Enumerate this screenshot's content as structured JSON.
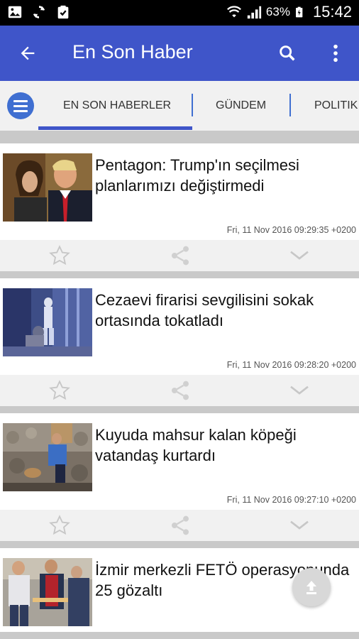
{
  "status_bar": {
    "battery": "63%",
    "time": "15:42"
  },
  "app_bar": {
    "title": "En Son Haber"
  },
  "tabs": [
    {
      "label": "EN SON HABERLER",
      "selected": true
    },
    {
      "label": "GÜNDEM",
      "selected": false
    },
    {
      "label": "POLITIK",
      "selected": false
    }
  ],
  "articles": [
    {
      "headline": "Pentagon: Trump'ın seçilmesi planlarımızı değiştirmedi",
      "date": "Fri, 11 Nov 2016 09:29:35 +0200"
    },
    {
      "headline": "Cezaevi firarisi sevgilisini sokak ortasında tokatladı",
      "date": "Fri, 11 Nov 2016 09:28:20 +0200"
    },
    {
      "headline": "Kuyuda mahsur kalan köpeği vatandaş kurtardı",
      "date": "Fri, 11 Nov 2016 09:27:10 +0200"
    },
    {
      "headline": "İzmir merkezli FETÖ operasyonunda 25 gözaltı",
      "date": ""
    }
  ],
  "colors": {
    "app_bar": "#3f55c9",
    "accent": "#3f6fd1",
    "tab_bar": "#f1f1f1",
    "list_background": "#c9c9c9"
  },
  "icons": {
    "back": "back-arrow-icon",
    "search": "search-icon",
    "overflow": "more-vert-icon",
    "menu": "menu-icon",
    "favorite": "star-icon",
    "share": "share-icon",
    "expand": "chevron-down-icon",
    "scroll_top": "upload-arrow-icon"
  }
}
